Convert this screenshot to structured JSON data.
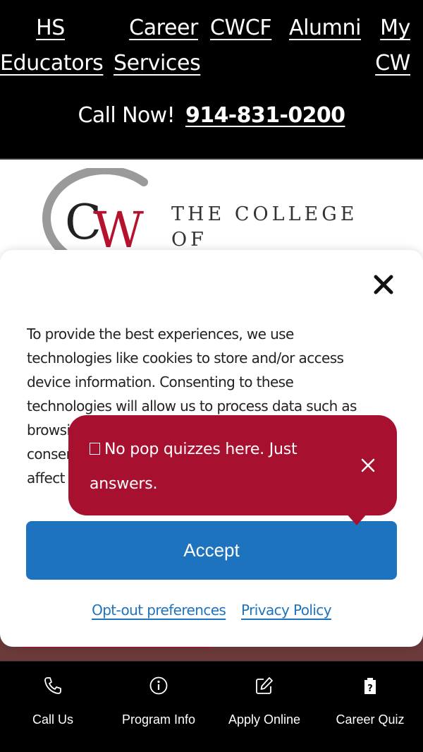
{
  "topnav": {
    "links": [
      {
        "line1": "HS",
        "line2": "Educators"
      },
      {
        "line1": "Career",
        "line2": "Services"
      },
      {
        "line1": "CWCF",
        "line2": ""
      },
      {
        "line1": "Alumni",
        "line2": ""
      },
      {
        "line1": "My",
        "line2": "CW"
      }
    ],
    "call_prefix": "Call Now!",
    "phone": "914-831-0200"
  },
  "logo": {
    "line1": "THE COLLEGE",
    "line2": "OF WESTCHESTER",
    "mark": "®",
    "colors": {
      "dark": "#333333",
      "red": "#b5122e",
      "grey": "#9a9a9a"
    }
  },
  "consent": {
    "text": "To provide the best experiences, we use technologies like cookies to store and/or access device information. Consenting to these technologies will allow us to process data such as browsing behavior or unique IDs on this site. Not consenting or withdrawing consent, may adversely affect certain features and functions.",
    "accept_label": "Accept",
    "optout_label": "Opt-out preferences",
    "privacy_label": "Privacy Policy",
    "close_icon": "close-icon"
  },
  "bubble": {
    "text": "No pop quizzes here. Just answers.",
    "close_icon": "close-icon"
  },
  "bottom_bar": {
    "items": [
      {
        "label": "Call Us",
        "icon": "phone-icon"
      },
      {
        "label": "Program Info",
        "icon": "info-icon"
      },
      {
        "label": "Apply Online",
        "icon": "edit-icon"
      },
      {
        "label": "Career Quiz",
        "icon": "quiz-icon"
      }
    ]
  },
  "colors": {
    "accent_blue": "#1e73be",
    "brand_red": "#a8102f",
    "black": "#000000"
  }
}
